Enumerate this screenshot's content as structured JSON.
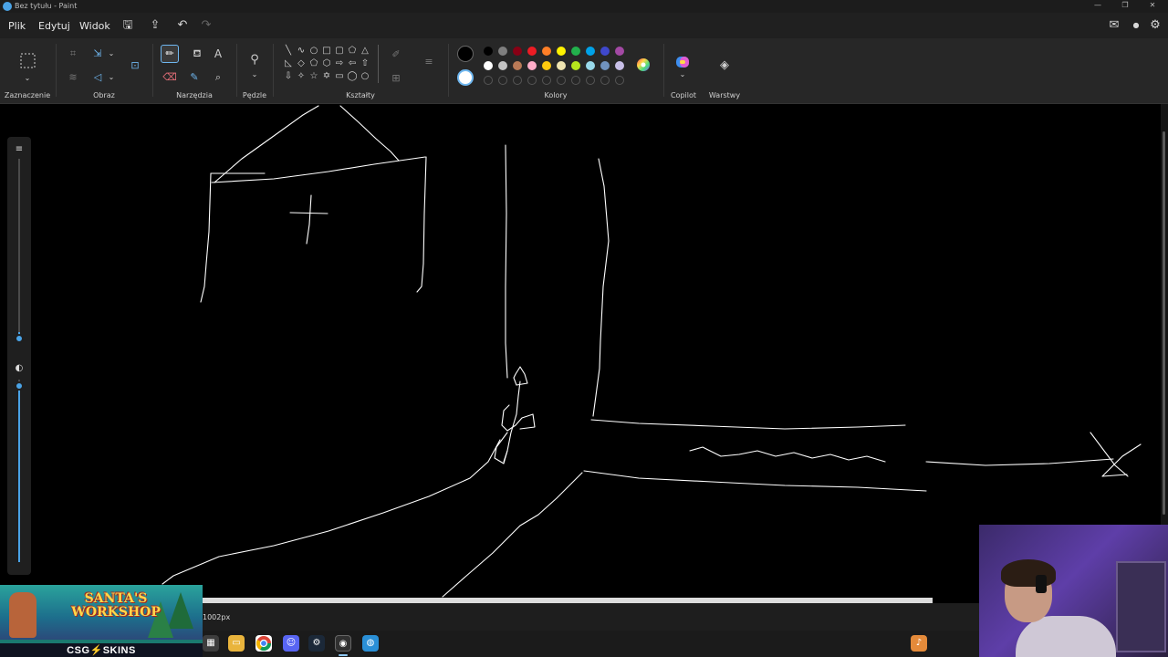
{
  "window": {
    "title": "Bez tytułu - Paint",
    "controls": [
      "—",
      "❐",
      "✕"
    ]
  },
  "menu": {
    "items": [
      "Plik",
      "Edytuj",
      "Widok"
    ],
    "icons": [
      "save-icon",
      "share-icon",
      "undo-icon",
      "redo-icon"
    ]
  },
  "ribbon": {
    "groups": {
      "selection": "Zaznaczenie",
      "image": "Obraz",
      "tools": "Narzędzia",
      "brushes": "Pędzle",
      "shapes": "Kształty",
      "colors": "Kolory",
      "copilot": "Copilot",
      "layers": "Warstwy"
    },
    "active_tool": "pencil",
    "primary_color": "#000000",
    "secondary_color": "#ffffff",
    "palette_row1": [
      "#000000",
      "#7f7f7f",
      "#880015",
      "#ed1c24",
      "#ff7f27",
      "#fff200",
      "#22b14c",
      "#00a2e8",
      "#3f48cc",
      "#a349a4"
    ],
    "palette_row2": [
      "#ffffff",
      "#c3c3c3",
      "#b97a57",
      "#ffaec9",
      "#ffc90e",
      "#efe4b0",
      "#b5e61d",
      "#99d9ea",
      "#7092be",
      "#c8bfe7"
    ]
  },
  "statusbar": {
    "dimensions": "1002px"
  },
  "promo": {
    "logo": "SANTA'S WORKSHOP",
    "footer": "CSG⚡SKINS"
  },
  "taskbar": {
    "apps": [
      "windows-start-icon",
      "file-explorer-icon",
      "chrome-icon",
      "discord-icon",
      "steam-icon",
      "obs-icon",
      "paint-icon"
    ]
  }
}
